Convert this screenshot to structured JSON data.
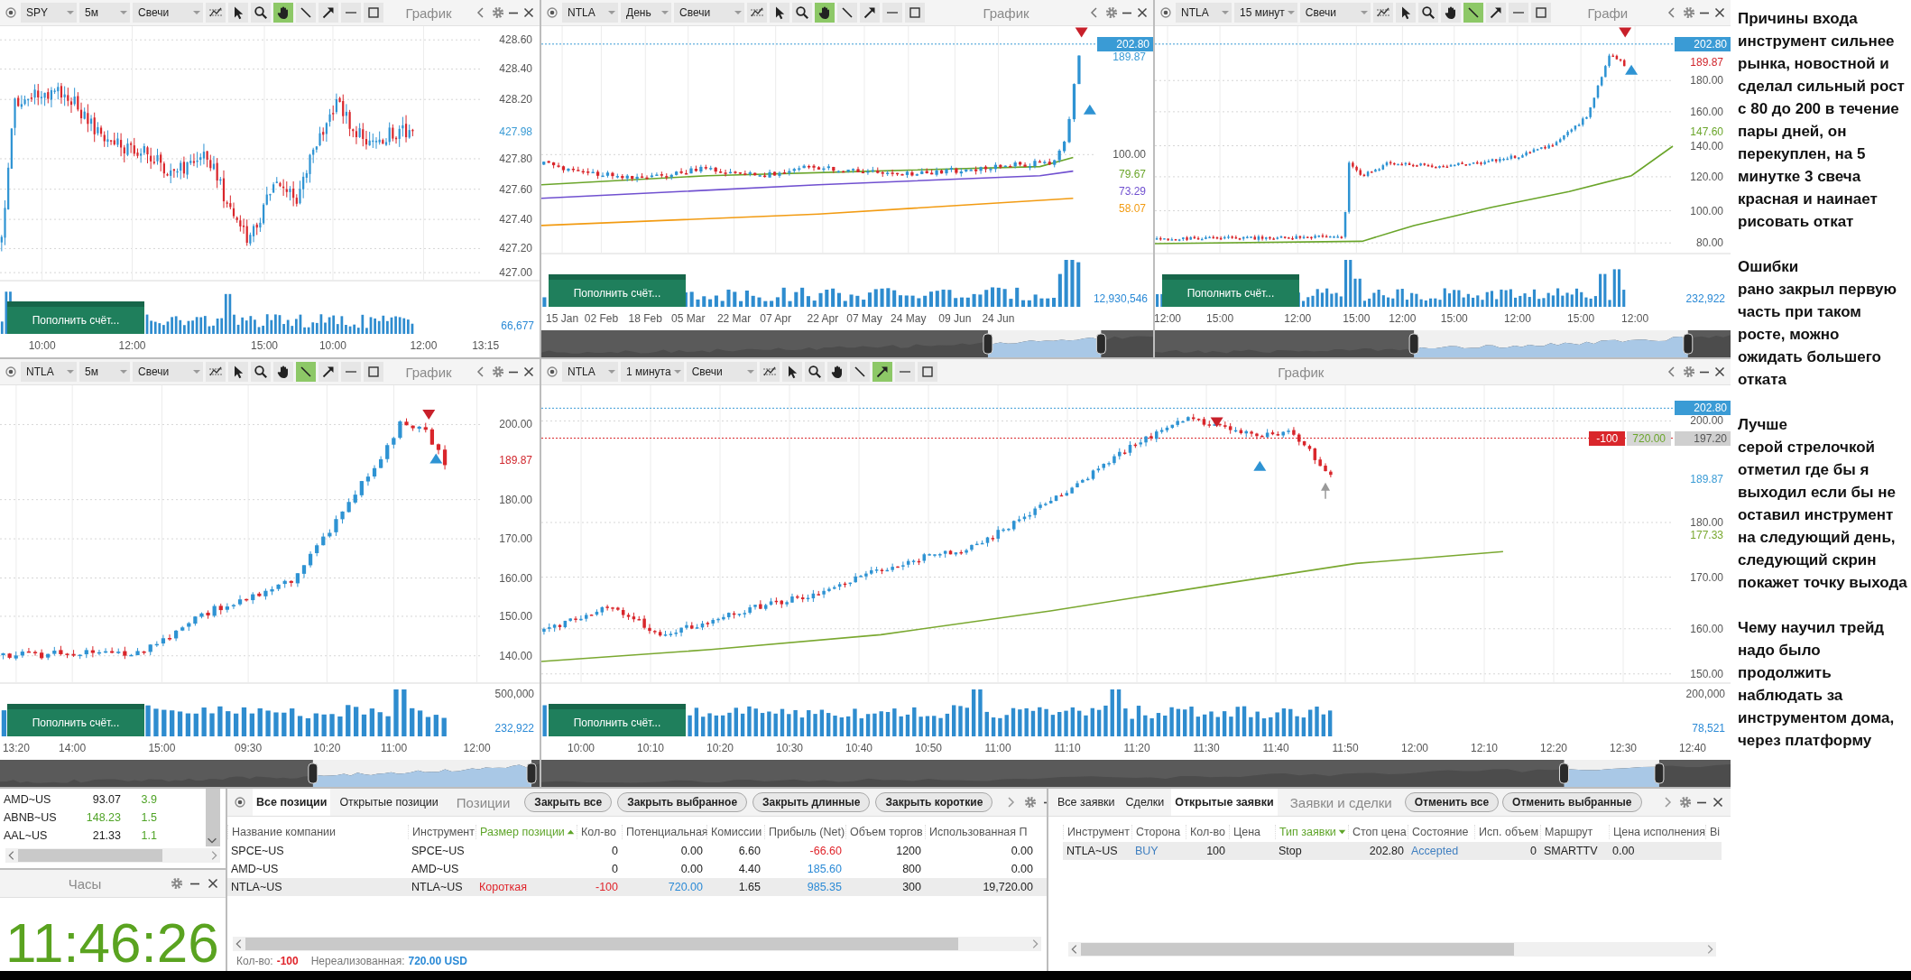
{
  "charts": [
    {
      "symbol": "SPY",
      "interval": "5м",
      "chart_type": "Свечи",
      "title": "График",
      "tools": [
        {
          "kind": "indicators",
          "selected": false
        },
        {
          "kind": "cursor",
          "selected": false
        },
        {
          "kind": "zoom",
          "selected": false
        },
        {
          "kind": "hand",
          "selected": true
        },
        {
          "kind": "line",
          "selected": false
        },
        {
          "kind": "arrow",
          "selected": false
        },
        {
          "kind": "hline",
          "selected": false
        },
        {
          "kind": "rect",
          "selected": false
        }
      ],
      "y_labels": [
        "428.60",
        "428.40",
        "428.20",
        "427.80",
        "427.60",
        "427.40",
        "427.20",
        "427.00"
      ],
      "price_tags": [
        {
          "text": "427.98",
          "kind": "text",
          "color": "#3a9bd5"
        }
      ],
      "volume_labels": [
        {
          "text": "66,677",
          "kind": "last"
        }
      ],
      "deposit_button": "Пополнить счёт...",
      "x_labels": [
        "10:00",
        "12:00",
        "15:00",
        "10:00",
        "12:00",
        "13:15"
      ]
    },
    {
      "symbol": "NTLA",
      "interval": "День",
      "chart_type": "Свечи",
      "title": "График",
      "tools": [
        {
          "kind": "indicators",
          "selected": false
        },
        {
          "kind": "cursor",
          "selected": false
        },
        {
          "kind": "zoom",
          "selected": false
        },
        {
          "kind": "hand",
          "selected": true
        },
        {
          "kind": "line",
          "selected": false
        },
        {
          "kind": "arrow",
          "selected": false
        },
        {
          "kind": "hline",
          "selected": false
        },
        {
          "kind": "rect",
          "selected": false
        }
      ],
      "y_labels": [
        "100.00"
      ],
      "price_tags": [
        {
          "text": "202.80",
          "kind": "box",
          "color": "#3a9bd5"
        },
        {
          "text": "189.87",
          "kind": "text",
          "color": "#3a9bd5"
        },
        {
          "text": "79.67",
          "kind": "text",
          "color": "#6aa52a"
        },
        {
          "text": "73.29",
          "kind": "text",
          "color": "#7050d0"
        },
        {
          "text": "58.07",
          "kind": "text",
          "color": "#f29b12"
        }
      ],
      "volume_labels": [
        {
          "text": "12,930,546",
          "kind": "last"
        }
      ],
      "deposit_button": "Пополнить счёт...",
      "x_labels": [
        "15 Jan",
        "02 Feb",
        "18 Feb",
        "05 Mar",
        "22 Mar",
        "07 Apr",
        "22 Apr",
        "07 May",
        "24 May",
        "09 Jun",
        "24 Jun"
      ],
      "navigator": true
    },
    {
      "symbol": "NTLA",
      "interval": "15 минут",
      "chart_type": "Свечи",
      "title": "Графи",
      "tools": [
        {
          "kind": "indicators",
          "selected": false
        },
        {
          "kind": "cursor",
          "selected": false
        },
        {
          "kind": "zoom",
          "selected": false
        },
        {
          "kind": "hand",
          "selected": false
        },
        {
          "kind": "line",
          "selected": true
        },
        {
          "kind": "arrow",
          "selected": false
        },
        {
          "kind": "hline",
          "selected": false
        },
        {
          "kind": "rect",
          "selected": false
        }
      ],
      "y_labels": [
        "180.00",
        "160.00",
        "140.00",
        "120.00",
        "100.00",
        "80.00"
      ],
      "price_tags": [
        {
          "text": "202.80",
          "kind": "box",
          "color": "#3a9bd5"
        },
        {
          "text": "189.87",
          "kind": "text",
          "color": "#d0262d"
        },
        {
          "text": "147.60",
          "kind": "text",
          "color": "#6aa52a"
        }
      ],
      "volume_labels": [
        {
          "text": "232,922",
          "kind": "last"
        }
      ],
      "deposit_button": "Пополнить счёт...",
      "x_labels": [
        "12:00",
        "15:00",
        "12:00",
        "15:00",
        "12:00",
        "15:00",
        "12:00",
        "15:00",
        "12:00"
      ],
      "navigator": true
    },
    {
      "symbol": "NTLA",
      "interval": "5м",
      "chart_type": "Свечи",
      "title": "График",
      "tools": [
        {
          "kind": "indicators",
          "selected": false
        },
        {
          "kind": "cursor",
          "selected": false
        },
        {
          "kind": "zoom",
          "selected": false
        },
        {
          "kind": "hand",
          "selected": false
        },
        {
          "kind": "line",
          "selected": true
        },
        {
          "kind": "arrow",
          "selected": false
        },
        {
          "kind": "hline",
          "selected": false
        },
        {
          "kind": "rect",
          "selected": false
        }
      ],
      "y_labels": [
        "200.00",
        "180.00",
        "170.00",
        "160.00",
        "150.00",
        "140.00"
      ],
      "price_tags": [
        {
          "text": "189.87",
          "kind": "text",
          "color": "#d0262d"
        }
      ],
      "volume_labels": [
        {
          "text": "500,000",
          "kind": "scale"
        },
        {
          "text": "232,922",
          "kind": "last"
        }
      ],
      "deposit_button": "Пополнить счёт...",
      "x_labels": [
        "13:20",
        "14:00",
        "15:00",
        "09:30",
        "10:20",
        "11:00",
        "12:00"
      ],
      "navigator": true
    },
    {
      "symbol": "NTLA",
      "interval": "1 минута",
      "chart_type": "Свечи",
      "title": "График",
      "tools": [
        {
          "kind": "indicators",
          "selected": false
        },
        {
          "kind": "cursor",
          "selected": false
        },
        {
          "kind": "zoom",
          "selected": false
        },
        {
          "kind": "hand",
          "selected": false
        },
        {
          "kind": "line",
          "selected": false
        },
        {
          "kind": "arrow",
          "selected": true
        },
        {
          "kind": "hline",
          "selected": false
        },
        {
          "kind": "rect",
          "selected": false
        }
      ],
      "y_labels": [
        "200.00",
        "180.00",
        "170.00",
        "160.00",
        "150.00"
      ],
      "price_tags": [
        {
          "text": "202.80",
          "kind": "box",
          "color": "#3a9bd5"
        },
        {
          "text": "197.20",
          "kind": "box",
          "color": "#cfcfcf"
        },
        {
          "text": "189.87",
          "kind": "text",
          "color": "#3a9bd5"
        },
        {
          "text": "177.33",
          "kind": "text",
          "color": "#7aa830"
        }
      ],
      "order_line": {
        "quantity": "-100",
        "profit": "720.00"
      },
      "volume_labels": [
        {
          "text": "200,000",
          "kind": "scale"
        },
        {
          "text": "78,521",
          "kind": "last"
        }
      ],
      "deposit_button": "Пополнить счёт...",
      "x_labels": [
        "10:00",
        "10:10",
        "10:20",
        "10:30",
        "10:40",
        "10:50",
        "11:00",
        "11:10",
        "11:20",
        "11:30",
        "11:40",
        "11:50",
        "12:00",
        "12:10",
        "12:20",
        "12:30",
        "12:40"
      ],
      "navigator": true
    }
  ],
  "watchlist": {
    "rows": [
      {
        "cells": [
          {
            "text": "AMD~US"
          },
          {
            "text": "93.07"
          },
          {
            "text": "3.9",
            "color": "#4fa326"
          }
        ]
      },
      {
        "cells": [
          {
            "text": "ABNB~US"
          },
          {
            "text": "148.23",
            "color": "#4fa326"
          },
          {
            "text": "1.5",
            "color": "#4fa326"
          }
        ]
      },
      {
        "cells": [
          {
            "text": "AAL~US"
          },
          {
            "text": "21.33"
          },
          {
            "text": "1.1",
            "color": "#4fa326"
          }
        ]
      }
    ]
  },
  "clock": {
    "title": "Часы",
    "time": "11:46:26"
  },
  "positions": {
    "tabs": [
      {
        "label": "Все позиции",
        "selected": true
      },
      {
        "label": "Открытые позиции",
        "selected": false
      }
    ],
    "title": "Позиции",
    "buttons": [
      "Закрыть все",
      "Закрыть выбранное",
      "Закрыть длинные",
      "Закрыть короткие"
    ],
    "columns": [
      {
        "label": "Название компании",
        "sorted": false
      },
      {
        "label": "Инструмент",
        "sorted": false
      },
      {
        "label": "Размер позиции",
        "sorted": true,
        "ascending": true
      },
      {
        "label": "Кол-во",
        "sorted": false
      },
      {
        "label": "Потенциальная",
        "sorted": false
      },
      {
        "label": "Комиссии",
        "sorted": false
      },
      {
        "label": "Прибыль (Net)",
        "sorted": false
      },
      {
        "label": "Объем торгов",
        "sorted": false
      },
      {
        "label": "Использованная П",
        "sorted": false
      }
    ],
    "rows": [
      {
        "selected": false,
        "cells": [
          {
            "text": "SPCE~US"
          },
          {
            "text": "SPCE~US"
          },
          null,
          {
            "text": "0"
          },
          {
            "text": "0.00"
          },
          {
            "text": "6.60"
          },
          {
            "text": "-66.60",
            "color": "#e0242b"
          },
          {
            "text": "1200"
          },
          {
            "text": "0.00"
          }
        ]
      },
      {
        "selected": false,
        "cells": [
          {
            "text": "AMD~US"
          },
          {
            "text": "AMD~US"
          },
          null,
          {
            "text": "0"
          },
          {
            "text": "0.00"
          },
          {
            "text": "4.40"
          },
          {
            "text": "185.60",
            "color": "#2b8ad6"
          },
          {
            "text": "800"
          },
          {
            "text": "0.00"
          }
        ]
      },
      {
        "selected": true,
        "cells": [
          {
            "text": "NTLA~US"
          },
          {
            "text": "NTLA~US"
          },
          {
            "text": "Короткая",
            "color": "#e0242b"
          },
          {
            "text": "-100",
            "color": "#e0242b"
          },
          {
            "text": "720.00",
            "color": "#2b8ad6"
          },
          {
            "text": "1.65"
          },
          {
            "text": "985.35",
            "color": "#2b8ad6"
          },
          {
            "text": "300"
          },
          {
            "text": "19,720.00"
          }
        ]
      }
    ],
    "footer": {
      "quantity_label": "Кол-во:",
      "quantity": "-100",
      "unrealized_label": "Нереализованная:",
      "unrealized": "720.00 USD"
    }
  },
  "orders": {
    "tabs": [
      {
        "label": "Все заявки",
        "selected": false
      },
      {
        "label": "Сделки",
        "selected": false
      },
      {
        "label": "Открытые заявки",
        "selected": true
      }
    ],
    "title": "Заявки и сделки",
    "buttons": [
      "Отменить все",
      "Отменить выбранные"
    ],
    "columns": [
      {
        "label": "Инструмент",
        "sorted": false
      },
      {
        "label": "Сторона",
        "sorted": false
      },
      {
        "label": "Кол-во",
        "sorted": false
      },
      {
        "label": "Цена",
        "sorted": false
      },
      {
        "label": "Тип заявки",
        "sorted": true,
        "ascending": false
      },
      {
        "label": "Стоп цена",
        "sorted": false
      },
      {
        "label": "Состояние",
        "sorted": false
      },
      {
        "label": "Исп. объем",
        "sorted": false
      },
      {
        "label": "Маршрут",
        "sorted": false
      },
      {
        "label": "Цена исполнения",
        "sorted": false
      },
      {
        "label": "Ві",
        "sorted": false
      }
    ],
    "rows": [
      {
        "selected": true,
        "cells": [
          {
            "text": "NTLA~US"
          },
          {
            "text": "BUY",
            "color": "#3f7fc0"
          },
          {
            "text": "100"
          },
          null,
          {
            "text": "Stop"
          },
          {
            "text": "202.80"
          },
          {
            "text": "Accepted",
            "color": "#3f7fc0"
          },
          {
            "text": "0"
          },
          {
            "text": "SMARTTV"
          },
          {
            "text": "0.00"
          }
        ]
      }
    ]
  },
  "notes": [
    {
      "heading": "Причины входа",
      "text": "инструмент сильнее рынка, новостной и сделал сильный рост с 80 до 200 в течение пары дней, он перекуплен, на 5 минутке 3 свеча красная и наинает рисовать откат"
    },
    {
      "heading": "Ошибки",
      "text": "рано закрыл первую часть при таком росте, можно ожидать большего отката"
    },
    {
      "heading": "Лучше",
      "text": "серой стрелочкой отметил где бы я выходил если бы не оставил инструмент на следующий день, следующий скрин покажет точку выхода"
    },
    {
      "heading": "Чему научил трейд",
      "text": "надо было продолжить наблюдать за инструментом дома, через платформу"
    }
  ]
}
